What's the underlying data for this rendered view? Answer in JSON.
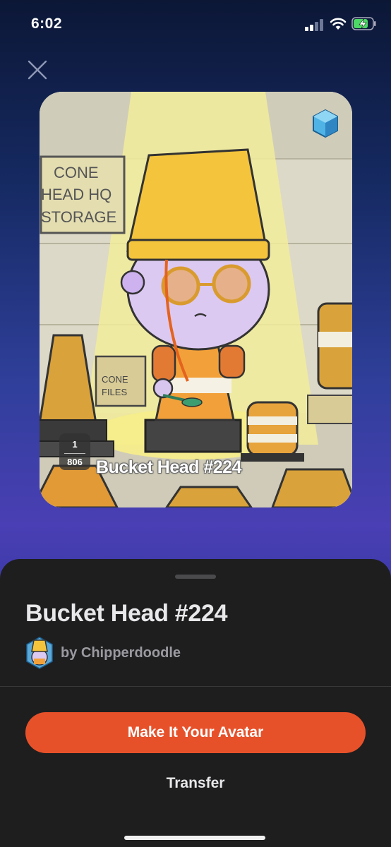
{
  "status_bar": {
    "time": "6:02"
  },
  "nft": {
    "title_overlay": "Bucket Head #224",
    "edition_number": "1",
    "edition_total": "806",
    "sign_text": [
      "CONE",
      "HEAD HQ",
      "STORAGE"
    ],
    "box_text": [
      "CONE",
      "FILES"
    ]
  },
  "sheet": {
    "title": "Bucket Head #224",
    "creator_label": "by Chipperdoodle",
    "primary_button": "Make It Your Avatar",
    "secondary_button": "Transfer"
  },
  "colors": {
    "accent": "#e7512a",
    "sheet_bg": "#1e1e1f"
  }
}
